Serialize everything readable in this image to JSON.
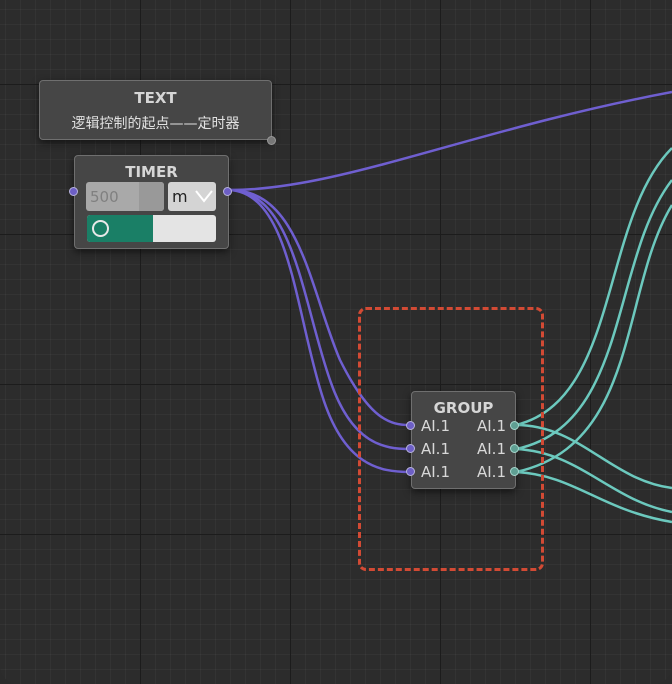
{
  "colors": {
    "canvas_bg": "#2c2c2c",
    "wire_purple": "#6f5fd0",
    "wire_teal": "#6cc9be",
    "toggle_on": "#1a7f66",
    "selection": "#d24a34"
  },
  "text_node": {
    "title": "TEXT",
    "body": "逻辑控制的起点——定时器"
  },
  "timer_node": {
    "title": "TIMER",
    "interval_value": "500",
    "unit_value": "m",
    "unit_icon": "chevron-down-icon",
    "toggle_state": "on",
    "toggle_icon": "circle-icon"
  },
  "group_node": {
    "title": "GROUP",
    "inputs": [
      "AI.1",
      "AI.1",
      "AI.1"
    ],
    "outputs": [
      "AI.1",
      "AI.1",
      "AI.1"
    ]
  }
}
